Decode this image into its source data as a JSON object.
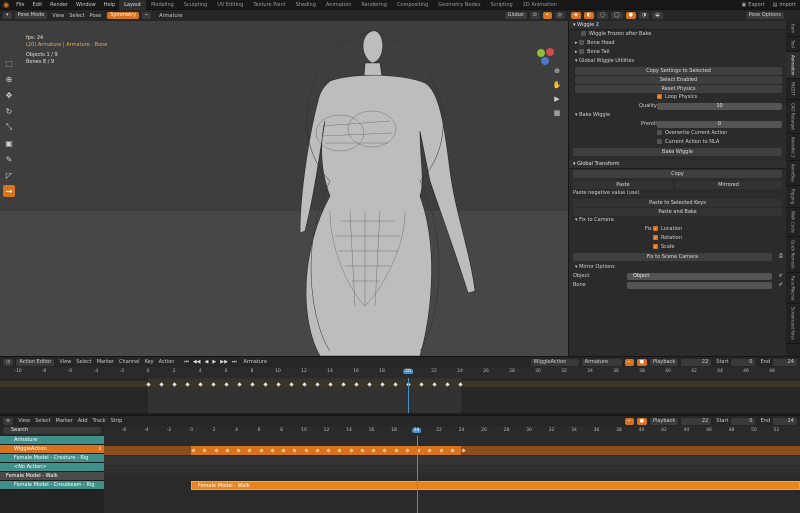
{
  "menubar": {
    "menus": [
      "File",
      "Edit",
      "Render",
      "Window",
      "Help"
    ],
    "workspaces": [
      "Layout",
      "Modeling",
      "Sculpting",
      "UV Editing",
      "Texture Paint",
      "Shading",
      "Animation",
      "Rendering",
      "Compositing",
      "Geometry Nodes",
      "Scripting",
      "2D Animation"
    ],
    "active_workspace": "Layout",
    "scene": "Export",
    "view_layer": "Import"
  },
  "viewport_header": {
    "mode": "Pose Mode",
    "menus": [
      "View",
      "Select",
      "Pose"
    ],
    "symmetry_label": "Symmetry",
    "armature_label": "Armature",
    "orientation": "Global",
    "pose_options": "Pose Options"
  },
  "viewport": {
    "info": {
      "fps": "fps: 24",
      "object_line": "(20) Armature | Armature : Bone",
      "objects": "Objects     1 / 9",
      "bones": "Bones       8 / 9"
    },
    "tools": [
      "select-box-icon",
      "cursor-icon",
      "move-icon",
      "rotate-icon",
      "scale-icon",
      "transform-icon",
      "annotate-icon",
      "measure-icon",
      "pose-relax-icon"
    ],
    "active_tool_index": 8
  },
  "properties": {
    "wiggle": {
      "title": "Wiggle 2",
      "frozen_label": "Wiggle Frozen after Bake",
      "bone_head": "Bone Head",
      "bone_tail": "Bone Tail",
      "global_utilities": "Global Wiggle Utilities",
      "copy_settings": "Copy Settings to Selected",
      "select_enabled": "Select Enabled",
      "reset_physics": "Reset Physics",
      "loop_physics": "Loop Physics",
      "quality_label": "Quality",
      "quality_value": "10",
      "bake_wiggle_section": "Bake Wiggle",
      "preroll_label": "Preroll",
      "preroll_value": "0",
      "overwrite": "Overwrite Current Action",
      "to_nla": "Current Action to NLA",
      "bake_button": "Bake Wiggle"
    },
    "global_transform": {
      "title": "Global Transform",
      "copy": "Copy",
      "paste": "Paste",
      "mirrored": "Mirrored",
      "paste_hint": "Paste negative value (use)",
      "paste_to_selected": "Paste to Selected Keys",
      "paste_and_bake": "Paste and Bake",
      "fix_to_camera": "Fix to Camera",
      "fix_label": "Fix",
      "location": "Location",
      "rotation": "Rotation",
      "scale": "Scale",
      "fix_scene_camera": "Fix to Scene Camera",
      "mirror_options": "Mirror Options",
      "object_label": "Object",
      "object_placeholder": "Object",
      "bone_label": "Bone"
    },
    "side_tabs": [
      "Item",
      "Tool",
      "Animation",
      "FACEIT",
      "CAO Retarget",
      "AnimAid 3",
      "AnimBay",
      "Rigging",
      "Walk Cycle",
      "Quick Remesh",
      "Face Macros",
      "Screencast Keys"
    ]
  },
  "action_editor": {
    "editor_type": "Action Editor",
    "menus": [
      "View",
      "Select",
      "Marker",
      "Channel",
      "Key",
      "Action"
    ],
    "armature_label": "Armature",
    "action_name": "WiggleAction",
    "object_name": "Armature",
    "playback": "Playback",
    "current_frame": "22",
    "start_label": "Start",
    "start_value": "0",
    "end_label": "End",
    "end_value": "24",
    "ruler": [
      "-10",
      "-8",
      "-6",
      "-4",
      "-2",
      "0",
      "2",
      "4",
      "6",
      "8",
      "10",
      "12",
      "14",
      "16",
      "18",
      "20",
      "22",
      "24",
      "26",
      "28",
      "30",
      "32",
      "34",
      "36",
      "38",
      "40",
      "42",
      "44",
      "46",
      "48"
    ],
    "playhead": "20"
  },
  "nla_editor": {
    "menus": [
      "View",
      "Select",
      "Marker",
      "Add",
      "Track",
      "Strip"
    ],
    "search_placeholder": "Search",
    "playback": "Playback",
    "current_frame": "22",
    "start_label": "Start",
    "start_value": "0",
    "end_label": "End",
    "end_value": "24",
    "ruler": [
      "-6",
      "-4",
      "-2",
      "0",
      "2",
      "4",
      "6",
      "8",
      "10",
      "12",
      "14",
      "16",
      "18",
      "20",
      "22",
      "24",
      "26",
      "28",
      "30",
      "32",
      "34",
      "36",
      "38",
      "40",
      "42",
      "44",
      "46",
      "48",
      "50",
      "52"
    ],
    "playhead": "20",
    "tracks": [
      "Armature",
      "WiggleAction",
      "Female Model - Creature - Rig",
      "<No Action>",
      "Female Model - Walk",
      "Female Model - Crossbeam - Rig"
    ],
    "strip_label": "Female Model - Walk"
  },
  "colors": {
    "accent": "#d7731e",
    "teal": "#3f8f8a",
    "playhead": "#4a90c7"
  }
}
